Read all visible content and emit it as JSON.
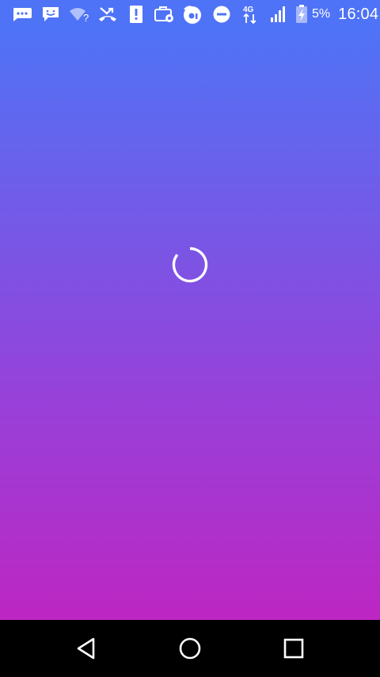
{
  "status_bar": {
    "battery_percent": "5%",
    "time": "16:04",
    "network_type": "4G",
    "icons": [
      "chat-bubble-icon",
      "messenger-icon",
      "wifi-unknown-icon",
      "missed-call-icon",
      "alert-sim-icon",
      "bag-settings-icon",
      "cloud-app-icon",
      "do-not-disturb-icon",
      "4g-data-icon",
      "signal-icon",
      "battery-charging-icon"
    ]
  },
  "app": {
    "state": "loading",
    "spinner_icon": "loading-spinner-icon",
    "background_gradient": [
      "#4f73f6",
      "#bd26c2"
    ]
  },
  "nav_bar": {
    "buttons": [
      "back-button",
      "home-button",
      "recents-button"
    ]
  },
  "colors": {
    "status_bar_bg": "#4f73f6",
    "nav_bar_bg": "#000000",
    "icon_color": "#ffffff"
  }
}
